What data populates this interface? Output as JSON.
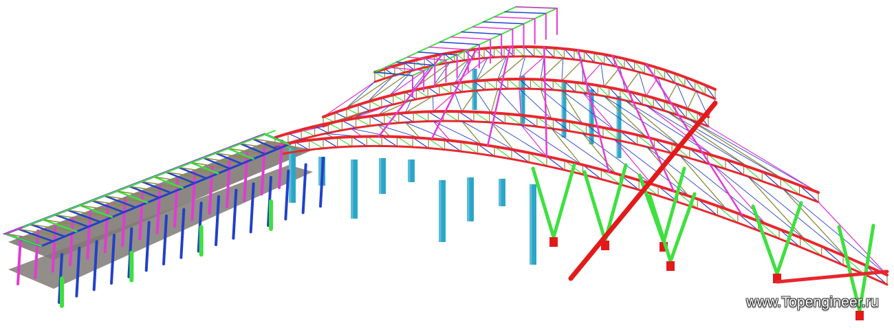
{
  "figure": {
    "watermark": "www.Topengineer.ru"
  },
  "colors": {
    "background": "#ffffff",
    "chord_red": "#e8262e",
    "column_cyan": "#2aa6c8",
    "brace_green": "#3ee03e",
    "web_magenta": "#e23ad6",
    "purlin_blue": "#2340c8",
    "beam_olive": "#8a8a3a",
    "slab_gray": "#7f7a76",
    "base_red": "#e21a1a"
  }
}
